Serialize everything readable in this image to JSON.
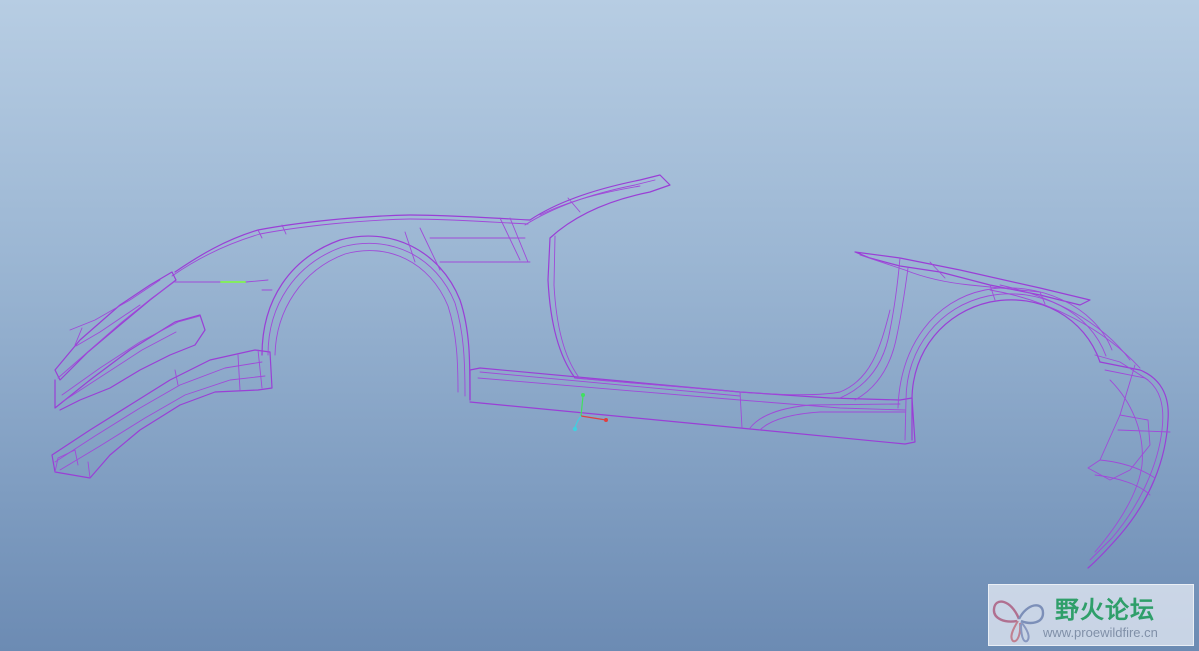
{
  "watermark": {
    "title": "野火论坛",
    "url": "www.proewildfire.cn",
    "logo_icon": "butterfly-logo-icon"
  },
  "viewport": {
    "background_top": "#b7cde3",
    "background_bottom": "#6c8bb3",
    "wire_color": "#9a3fd6",
    "highlight_color": "#7dff3a"
  },
  "triad": {
    "x_color": "#e04040",
    "y_color": "#40e060",
    "z_color": "#40d0e0"
  }
}
